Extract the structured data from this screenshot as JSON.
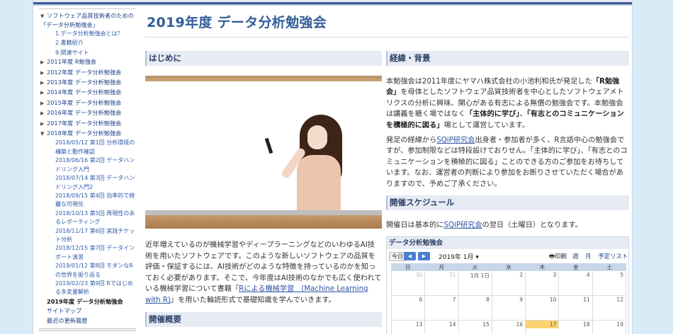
{
  "sidebar": {
    "root_label": "ソフトウェア品質技術者のための「データ分析勉強会」",
    "root_children": [
      "1.データ分析勉強会とは？",
      "2.書籍紹介",
      "9.関連サイト"
    ],
    "years": [
      "2011年度 R勉強会",
      "2012年度 データ分析勉強会",
      "2013年度 データ分析勉強会",
      "2014年度 データ分析勉強会",
      "2015年度 データ分析勉強会",
      "2016年度 データ分析勉強会",
      "2017年度 データ分析勉強会"
    ],
    "expanded_year": "2018年度 データ分析勉強会",
    "sessions": [
      "2018/05/12 第1回 分析環境の構築と動作確認",
      "2018/06/16 第2回 データハンドリング入門",
      "2018/07/14 第3回 データハンドリング入門2",
      "2018/09/15 第4回 効率的で綺麗な可視化",
      "2018/10/13 第5回 再現性のあるレポーティング",
      "2018/11/17 第6回 実践チケット分析",
      "2018/12/15 第7回 データインポート演習",
      "2019/01/12 第8回 モダンなRの世界を振り返る",
      "2019/02/23 第9回 Rではじめる多変量解析"
    ],
    "tail": [
      "2019年度 データ分析勉強会",
      "サイトマップ",
      "最近の更新履歴"
    ]
  },
  "main": {
    "title": "2019年度 データ分析勉強会",
    "sec_intro": "はじめに",
    "intro_text_1": "近年増えているのが機械学習やディープラーニングなどのいわゆるAI技術を用いたソフトウェアです。このような新しいソフトウェアの品質を評価・保証するには、AI技術がどのような特徴を持っているのかを知っておく必要があります。そこで、今年度はAI技術のなかでも広く使われている機械学習について書籍『",
    "intro_link": "Rによる機械学習　(Machine Learning with R)",
    "intro_text_2": "』を用いた輪読形式で基礎知識を学んでいきます。",
    "sec_overview": "開催概要",
    "sec_background": "経緯・背景",
    "bg_p1_a": "本勉強会は2011年度にヤマハ株式会社の小池利和氏が発足した",
    "bg_p1_b": "「R勉強会」",
    "bg_p1_c": "を母体としたソフトウェア品質技術者を中心としたソフトウェアメトリクスの分析に興味、関心がある有志による無償の勉強会です。本勉強会は講義を聴く場ではなく",
    "bg_p1_d": "「主体的に学び」",
    "bg_p1_e": "、",
    "bg_p1_f": "「有志とのコミュニケーションを積極的に図る」",
    "bg_p1_g": "場として運営しています。",
    "bg_p2_a": "発足の経緯から",
    "bg_p2_link": "SQiP研究会",
    "bg_p2_b": "出身者・参加者が多く、R言語中心の勉強会ですが、参加制限などは特段設けておりせん。「主体的に学び」、「有志とのコミュニケーションを積極的に図る」ことのできる方のご参加をお待ちしています。なお、運営者の判断により参加をお断りさせていただく場合がありますので、予めご了承ください。",
    "sec_schedule": "開催スケジュール",
    "sched_a": "開催日は基本的に",
    "sched_link": "SQiP研究会",
    "sched_b": "の翌日（土曜日）となります。"
  },
  "calendar": {
    "title": "データ分析勉強会",
    "today_label": "今日",
    "prev_label": "◀",
    "next_label": "▶",
    "month_label": "2019年 1月 ▾",
    "print_label": "印刷",
    "views": [
      "週",
      "月",
      "予定リスト"
    ],
    "weekdays": [
      "日",
      "月",
      "火",
      "水",
      "木",
      "金",
      "土"
    ],
    "rows": [
      [
        "30",
        "31",
        "1月 1日",
        "2",
        "3",
        "4",
        "5"
      ],
      [
        "6",
        "7",
        "8",
        "9",
        "10",
        "11",
        "12"
      ],
      [
        "13",
        "14",
        "15",
        "16",
        "17",
        "18",
        "19"
      ]
    ]
  }
}
